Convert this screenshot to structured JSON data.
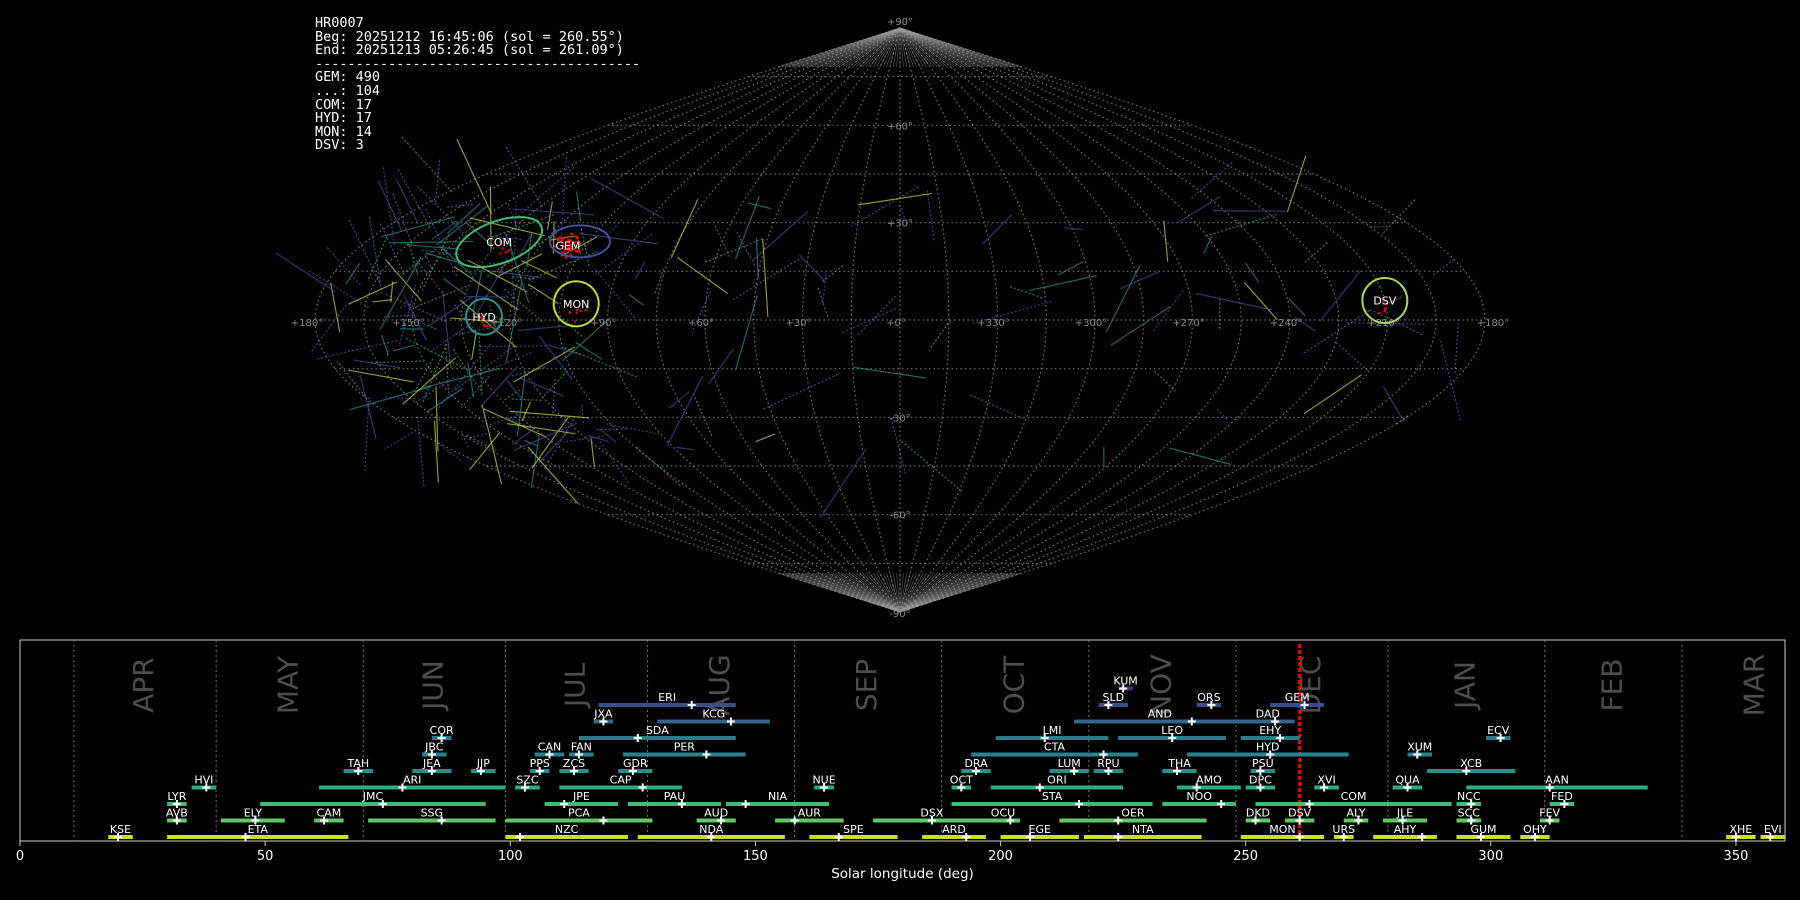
{
  "info": {
    "title": "HR0007",
    "begin": "Beg: 20251212 16:45:06 (sol = 260.55°)",
    "end": "End: 20251213 05:26:45 (sol = 261.09°)",
    "separator": "----------------------------------------",
    "counts": [
      {
        "label": "GEM: 490"
      },
      {
        "label": "...: 104"
      },
      {
        "label": "COM: 17"
      },
      {
        "label": "HYD: 17"
      },
      {
        "label": "MON: 14"
      },
      {
        "label": "DSV: 3"
      }
    ]
  },
  "colors": {
    "background": "#000000",
    "grid": "#9a9a9a",
    "marker": "#ff0000",
    "text": "#ffffff"
  },
  "chart_data": [
    {
      "type": "scatter",
      "projection": "sinusoidal",
      "lon_tick_labels": [
        "+180°",
        "+150°",
        "+120°",
        "+90°",
        "+60°",
        "+30°",
        "+0°",
        "+330°",
        "+300°",
        "+270°",
        "+240°",
        "+210°",
        "+180°"
      ],
      "lon_ticks": [
        180,
        150,
        120,
        90,
        60,
        30,
        0,
        -30,
        -60,
        -90,
        -120,
        -150,
        -180
      ],
      "lat_tick_labels": [
        "+90°",
        "+60°",
        "+30°",
        "-30°",
        "-60°",
        "-90°"
      ],
      "lat_ticks": [
        90,
        60,
        30,
        -30,
        -60,
        -90
      ],
      "showers": [
        {
          "name": "COM",
          "lon": 135,
          "lat": 24,
          "color": "#3dbb70",
          "rx": 9,
          "ry": 6
        },
        {
          "name": "GEM",
          "lon": 111,
          "lat": 23,
          "color": "#4a4a9e",
          "rx": 3,
          "ry": 2
        },
        {
          "name": "MON",
          "lon": 100,
          "lat": 5,
          "color": "#c3d63a",
          "rx": 5,
          "ry": 5
        },
        {
          "name": "HYD",
          "lon": 128,
          "lat": 1,
          "color": "#2c8f8f",
          "rx": 4,
          "ry": 4
        },
        {
          "name": "DSV",
          "lon": -150,
          "lat": 6,
          "color": "#a4d65e",
          "rx": 5,
          "ry": 5
        }
      ]
    },
    {
      "type": "timeline",
      "xlabel": "Solar longitude (deg)",
      "xlim": [
        0,
        360
      ],
      "xticks": [
        0,
        50,
        100,
        150,
        200,
        250,
        300,
        350
      ],
      "current_sol": 261,
      "months": [
        {
          "name": "APR",
          "start": 11
        },
        {
          "name": "MAY",
          "start": 40
        },
        {
          "name": "JUN",
          "start": 70
        },
        {
          "name": "JUL",
          "start": 99
        },
        {
          "name": "AUG",
          "start": 128
        },
        {
          "name": "SEP",
          "start": 158
        },
        {
          "name": "OCT",
          "start": 188
        },
        {
          "name": "NOV",
          "start": 218
        },
        {
          "name": "DEC",
          "start": 248
        },
        {
          "name": "JAN",
          "start": 279
        },
        {
          "name": "FEB",
          "start": 311
        },
        {
          "name": "MAR",
          "start": 339
        }
      ],
      "showers": [
        {
          "name": "KUM",
          "start": 224,
          "end": 227,
          "peak": 225,
          "row": 10,
          "color": "#472d7b"
        },
        {
          "name": "ERI",
          "start": 118,
          "end": 146,
          "peak": 137,
          "row": 9,
          "color": "#3b4e8c"
        },
        {
          "name": "SLD",
          "start": 220,
          "end": 226,
          "peak": 222,
          "row": 9,
          "color": "#3b4e8c"
        },
        {
          "name": "ORS",
          "start": 240,
          "end": 245,
          "peak": 243,
          "row": 9,
          "color": "#3b4e8c"
        },
        {
          "name": "GEM",
          "start": 255,
          "end": 266,
          "peak": 262,
          "row": 9,
          "color": "#3b4e8c"
        },
        {
          "name": "JXA",
          "start": 117,
          "end": 121,
          "peak": 119,
          "row": 8,
          "color": "#33658b"
        },
        {
          "name": "KCG",
          "start": 130,
          "end": 153,
          "peak": 145,
          "row": 8,
          "color": "#33658b"
        },
        {
          "name": "AND",
          "start": 215,
          "end": 250,
          "peak": 239,
          "row": 8,
          "color": "#33658b"
        },
        {
          "name": "DAD",
          "start": 249,
          "end": 260,
          "peak": 256,
          "row": 8,
          "color": "#33658b"
        },
        {
          "name": "COR",
          "start": 84,
          "end": 88,
          "peak": 86,
          "row": 7,
          "color": "#2d7a8c"
        },
        {
          "name": "SDA",
          "start": 114,
          "end": 146,
          "peak": 126,
          "row": 7,
          "color": "#2d7a8c"
        },
        {
          "name": "LMI",
          "start": 199,
          "end": 222,
          "peak": 209,
          "row": 7,
          "color": "#2d7a8c"
        },
        {
          "name": "LEO",
          "start": 224,
          "end": 246,
          "peak": 235,
          "row": 7,
          "color": "#2d7a8c"
        },
        {
          "name": "EHY",
          "start": 249,
          "end": 261,
          "peak": 257,
          "row": 7,
          "color": "#2d7a8c"
        },
        {
          "name": "ECV",
          "start": 299,
          "end": 304,
          "peak": 302,
          "row": 7,
          "color": "#2d7a8c"
        },
        {
          "name": "JBC",
          "start": 82,
          "end": 87,
          "peak": 84,
          "row": 6,
          "color": "#26828e"
        },
        {
          "name": "CAN",
          "start": 105,
          "end": 111,
          "peak": 108,
          "row": 6,
          "color": "#26828e"
        },
        {
          "name": "FAN",
          "start": 112,
          "end": 117,
          "peak": 114,
          "row": 6,
          "color": "#26828e"
        },
        {
          "name": "PER",
          "start": 123,
          "end": 148,
          "peak": 140,
          "row": 6,
          "color": "#26828e"
        },
        {
          "name": "CTA",
          "start": 194,
          "end": 228,
          "peak": 221,
          "row": 6,
          "color": "#26828e"
        },
        {
          "name": "HYD",
          "start": 238,
          "end": 271,
          "peak": 255,
          "row": 6,
          "color": "#26828e"
        },
        {
          "name": "XUM",
          "start": 283,
          "end": 288,
          "peak": 285,
          "row": 6,
          "color": "#26828e"
        },
        {
          "name": "TAH",
          "start": 66,
          "end": 72,
          "peak": 69,
          "row": 5,
          "color": "#21918c"
        },
        {
          "name": "JEA",
          "start": 80,
          "end": 88,
          "peak": 84,
          "row": 5,
          "color": "#21918c"
        },
        {
          "name": "JIP",
          "start": 92,
          "end": 97,
          "peak": 94,
          "row": 5,
          "color": "#21918c"
        },
        {
          "name": "PPS",
          "start": 104,
          "end": 108,
          "peak": 106,
          "row": 5,
          "color": "#21918c"
        },
        {
          "name": "ZCS",
          "start": 110,
          "end": 116,
          "peak": 113,
          "row": 5,
          "color": "#21918c"
        },
        {
          "name": "GDR",
          "start": 122,
          "end": 129,
          "peak": 125,
          "row": 5,
          "color": "#21918c"
        },
        {
          "name": "DRA",
          "start": 192,
          "end": 198,
          "peak": 195,
          "row": 5,
          "color": "#21918c"
        },
        {
          "name": "LUM",
          "start": 210,
          "end": 218,
          "peak": 215,
          "row": 5,
          "color": "#21918c"
        },
        {
          "name": "RPU",
          "start": 219,
          "end": 225,
          "peak": 222,
          "row": 5,
          "color": "#21918c"
        },
        {
          "name": "THA",
          "start": 233,
          "end": 240,
          "peak": 236,
          "row": 5,
          "color": "#21918c"
        },
        {
          "name": "PSU",
          "start": 251,
          "end": 256,
          "peak": 253,
          "row": 5,
          "color": "#21918c"
        },
        {
          "name": "XCB",
          "start": 287,
          "end": 305,
          "peak": 295,
          "row": 5,
          "color": "#21918c"
        },
        {
          "name": "HVI",
          "start": 35,
          "end": 40,
          "peak": 38,
          "row": 4,
          "color": "#28ae80"
        },
        {
          "name": "ARI",
          "start": 61,
          "end": 99,
          "peak": 78,
          "row": 4,
          "color": "#28ae80"
        },
        {
          "name": "SZC",
          "start": 101,
          "end": 106,
          "peak": 103,
          "row": 4,
          "color": "#28ae80"
        },
        {
          "name": "CAP",
          "start": 110,
          "end": 135,
          "peak": 127,
          "row": 4,
          "color": "#28ae80"
        },
        {
          "name": "NUE",
          "start": 162,
          "end": 166,
          "peak": 164,
          "row": 4,
          "color": "#28ae80"
        },
        {
          "name": "OCT",
          "start": 190,
          "end": 194,
          "peak": 192,
          "row": 4,
          "color": "#28ae80"
        },
        {
          "name": "ORI",
          "start": 198,
          "end": 225,
          "peak": 208,
          "row": 4,
          "color": "#28ae80"
        },
        {
          "name": "AMO",
          "start": 236,
          "end": 249,
          "peak": 240,
          "row": 4,
          "color": "#28ae80"
        },
        {
          "name": "DPC",
          "start": 250,
          "end": 256,
          "peak": 253,
          "row": 4,
          "color": "#28ae80"
        },
        {
          "name": "XVI",
          "start": 264,
          "end": 269,
          "peak": 266,
          "row": 4,
          "color": "#28ae80"
        },
        {
          "name": "QUA",
          "start": 280,
          "end": 286,
          "peak": 283,
          "row": 4,
          "color": "#28ae80"
        },
        {
          "name": "AAN",
          "start": 295,
          "end": 332,
          "peak": 312,
          "row": 4,
          "color": "#28ae80"
        },
        {
          "name": "LYR",
          "start": 30,
          "end": 34,
          "peak": 32,
          "row": 3,
          "color": "#3fbc73"
        },
        {
          "name": "JMC",
          "start": 49,
          "end": 95,
          "peak": 74,
          "row": 3,
          "color": "#3fbc73"
        },
        {
          "name": "JPE",
          "start": 107,
          "end": 122,
          "peak": 111,
          "row": 3,
          "color": "#3fbc73"
        },
        {
          "name": "PAU",
          "start": 124,
          "end": 143,
          "peak": 135,
          "row": 3,
          "color": "#3fbc73"
        },
        {
          "name": "NIA",
          "start": 144,
          "end": 165,
          "peak": 148,
          "row": 3,
          "color": "#3fbc73"
        },
        {
          "name": "STA",
          "start": 190,
          "end": 231,
          "peak": 216,
          "row": 3,
          "color": "#3fbc73"
        },
        {
          "name": "NOO",
          "start": 233,
          "end": 248,
          "peak": 245,
          "row": 3,
          "color": "#3fbc73"
        },
        {
          "name": "COM",
          "start": 252,
          "end": 292,
          "peak": 263,
          "row": 3,
          "color": "#3fbc73"
        },
        {
          "name": "NCC",
          "start": 293,
          "end": 298,
          "peak": 296,
          "row": 3,
          "color": "#3fbc73"
        },
        {
          "name": "FED",
          "start": 312,
          "end": 317,
          "peak": 315,
          "row": 3,
          "color": "#3fbc73"
        },
        {
          "name": "AVB",
          "start": 30,
          "end": 34,
          "peak": 32,
          "row": 2,
          "color": "#5ec962"
        },
        {
          "name": "ELY",
          "start": 41,
          "end": 54,
          "peak": 48,
          "row": 2,
          "color": "#5ec962"
        },
        {
          "name": "CAM",
          "start": 60,
          "end": 66,
          "peak": 62,
          "row": 2,
          "color": "#5ec962"
        },
        {
          "name": "SSG",
          "start": 71,
          "end": 97,
          "peak": 86,
          "row": 2,
          "color": "#5ec962"
        },
        {
          "name": "PCA",
          "start": 99,
          "end": 129,
          "peak": 119,
          "row": 2,
          "color": "#5ec962"
        },
        {
          "name": "AUD",
          "start": 138,
          "end": 146,
          "peak": 143,
          "row": 2,
          "color": "#5ec962"
        },
        {
          "name": "AUR",
          "start": 154,
          "end": 168,
          "peak": 158,
          "row": 2,
          "color": "#5ec962"
        },
        {
          "name": "DSX",
          "start": 174,
          "end": 198,
          "peak": 186,
          "row": 2,
          "color": "#5ec962"
        },
        {
          "name": "OCU",
          "start": 197,
          "end": 204,
          "peak": 202,
          "row": 2,
          "color": "#5ec962"
        },
        {
          "name": "OER",
          "start": 212,
          "end": 242,
          "peak": 224,
          "row": 2,
          "color": "#5ec962"
        },
        {
          "name": "DKD",
          "start": 250,
          "end": 255,
          "peak": 252,
          "row": 2,
          "color": "#5ec962"
        },
        {
          "name": "DSV",
          "start": 258,
          "end": 264,
          "peak": 261,
          "row": 2,
          "color": "#5ec962"
        },
        {
          "name": "ALY",
          "start": 270,
          "end": 275,
          "peak": 273,
          "row": 2,
          "color": "#5ec962"
        },
        {
          "name": "JLE",
          "start": 278,
          "end": 287,
          "peak": 282,
          "row": 2,
          "color": "#5ec962"
        },
        {
          "name": "SCC",
          "start": 293,
          "end": 298,
          "peak": 296,
          "row": 2,
          "color": "#5ec962"
        },
        {
          "name": "FEV",
          "start": 310,
          "end": 314,
          "peak": 312,
          "row": 2,
          "color": "#5ec962"
        },
        {
          "name": "KSE",
          "start": 18,
          "end": 23,
          "peak": 20,
          "row": 1,
          "color": "#c8e020"
        },
        {
          "name": "ETA",
          "start": 30,
          "end": 67,
          "peak": 46,
          "row": 1,
          "color": "#c8e020"
        },
        {
          "name": "NZC",
          "start": 99,
          "end": 124,
          "peak": 102,
          "row": 1,
          "color": "#c8e020"
        },
        {
          "name": "NDA",
          "start": 126,
          "end": 156,
          "peak": 141,
          "row": 1,
          "color": "#c8e020"
        },
        {
          "name": "SPE",
          "start": 161,
          "end": 179,
          "peak": 167,
          "row": 1,
          "color": "#c8e020"
        },
        {
          "name": "ARD",
          "start": 184,
          "end": 197,
          "peak": 193,
          "row": 1,
          "color": "#c8e020"
        },
        {
          "name": "EGE",
          "start": 200,
          "end": 216,
          "peak": 206,
          "row": 1,
          "color": "#c8e020"
        },
        {
          "name": "NTA",
          "start": 217,
          "end": 241,
          "peak": 224,
          "row": 1,
          "color": "#c8e020"
        },
        {
          "name": "MON",
          "start": 249,
          "end": 266,
          "peak": 261,
          "row": 1,
          "color": "#c8e020"
        },
        {
          "name": "URS",
          "start": 268,
          "end": 272,
          "peak": 270,
          "row": 1,
          "color": "#c8e020"
        },
        {
          "name": "AHY",
          "start": 276,
          "end": 289,
          "peak": 286,
          "row": 1,
          "color": "#c8e020"
        },
        {
          "name": "GUM",
          "start": 293,
          "end": 304,
          "peak": 298,
          "row": 1,
          "color": "#c8e020"
        },
        {
          "name": "OHY",
          "start": 306,
          "end": 312,
          "peak": 309,
          "row": 1,
          "color": "#c8e020"
        },
        {
          "name": "XHE",
          "start": 348,
          "end": 354,
          "peak": 350,
          "row": 1,
          "color": "#c8e020"
        },
        {
          "name": "EVI",
          "start": 355,
          "end": 360,
          "peak": 357,
          "row": 1,
          "color": "#c8e020"
        }
      ]
    }
  ]
}
